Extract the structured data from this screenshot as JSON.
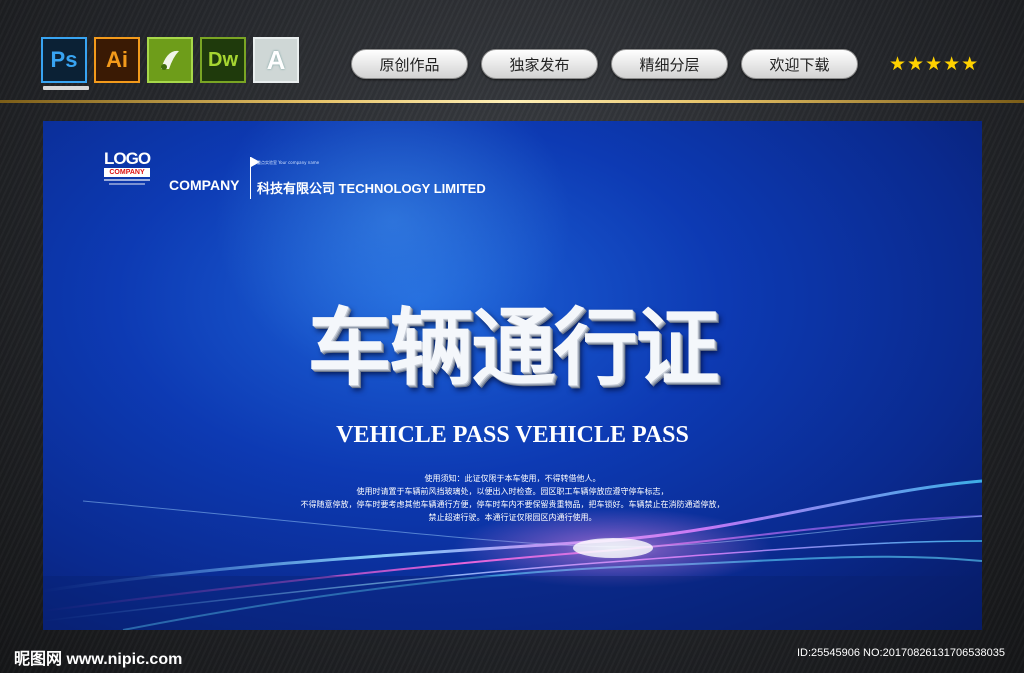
{
  "toolbar": {
    "software_icons": [
      {
        "name": "photoshop-icon",
        "label": "Ps"
      },
      {
        "name": "illustrator-icon",
        "label": "Ai"
      },
      {
        "name": "coreldraw-icon",
        "label": ""
      },
      {
        "name": "dreamweaver-icon",
        "label": "Dw"
      },
      {
        "name": "autocad-icon",
        "label": "A"
      }
    ],
    "tags": [
      "原创作品",
      "独家发布",
      "精细分层",
      "欢迎下载"
    ],
    "rating": "★★★★★",
    "rating_count": 5
  },
  "poster": {
    "logo": {
      "text": "LOGO",
      "sub": "COMPANY"
    },
    "company_short": "COMPANY",
    "tagline": "重点实验室 Your company name",
    "company_full": "科技有限公司 TECHNOLOGY LIMITED",
    "title": "车辆通行证",
    "subtitle": "VEHICLE PASS VEHICLE PASS",
    "notes": [
      "使用须知：此证仅限于本车使用，不得转借他人。",
      "使用时请置于车辆前风挡玻璃处，以便出入时检查。园区职工车辆停放应遵守停车标志，",
      "不得随意停放，停车时要考虑其他车辆通行方便，停车时车内不要保留贵重物品，把车锁好。车辆禁止在消防通道停放，",
      "禁止超速行驶。本通行证仅限园区内通行使用。"
    ],
    "colors": {
      "background": "#0d3ab3",
      "accent": "#e4c066"
    }
  },
  "footer": {
    "site": "昵图网 www.nipic.com",
    "id_line": "ID:25545906 NO:20170826131706538035"
  }
}
